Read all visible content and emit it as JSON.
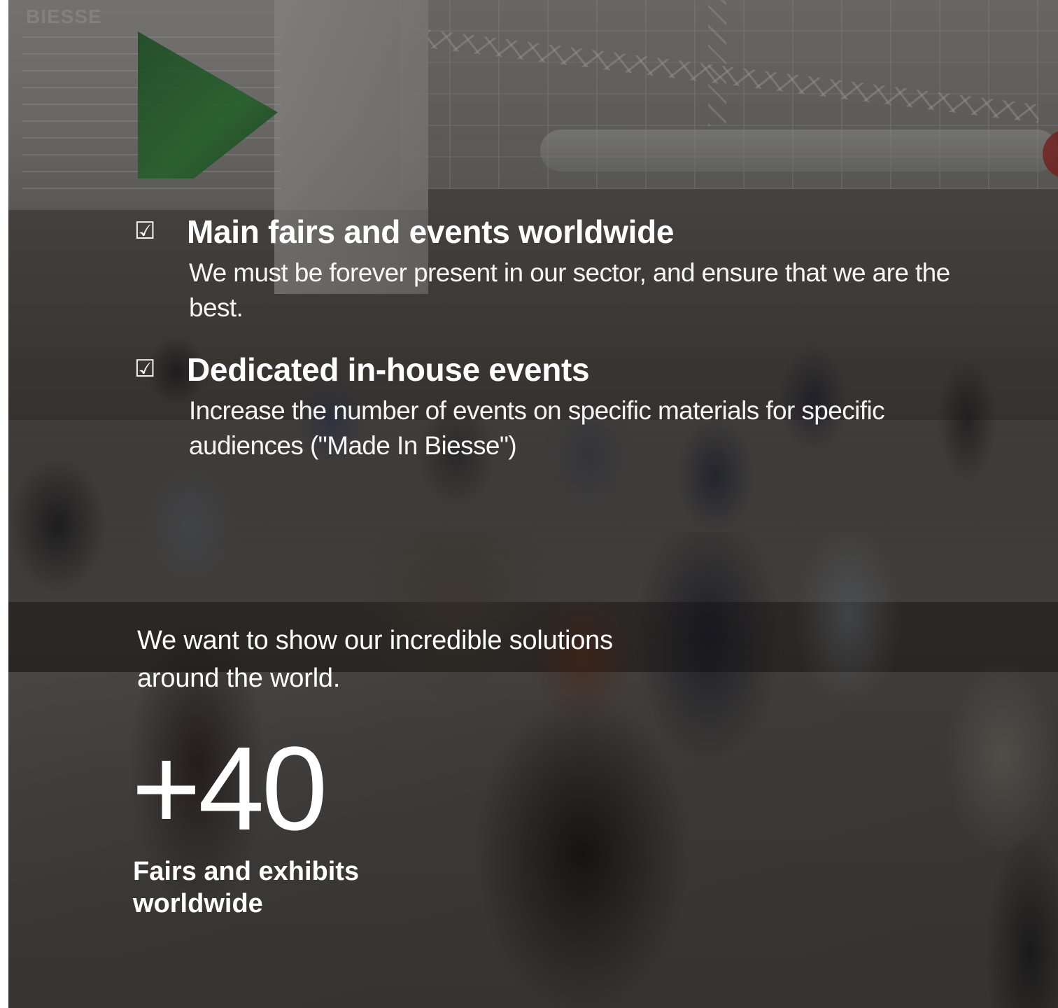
{
  "background": {
    "description_color": "#3f3a36",
    "overlay_opacity": 0.38,
    "brand_sign_text": "BIESSE"
  },
  "features": [
    {
      "icon": "ballot-box-with-check-icon",
      "glyph": "☑",
      "title": "Main fairs and events worldwide",
      "description": "We must be forever present in our sector, and ensure that we are the best."
    },
    {
      "icon": "ballot-box-with-check-icon",
      "glyph": "☑",
      "title": "Dedicated in-house events",
      "description": "Increase the number of events on specific materials for specific audiences (\"Made In Biesse\")"
    }
  ],
  "tagline": "We want to show our incredible solutions around the world.",
  "stat": {
    "number": "+40",
    "label": "Fairs and exhibits worldwide"
  }
}
